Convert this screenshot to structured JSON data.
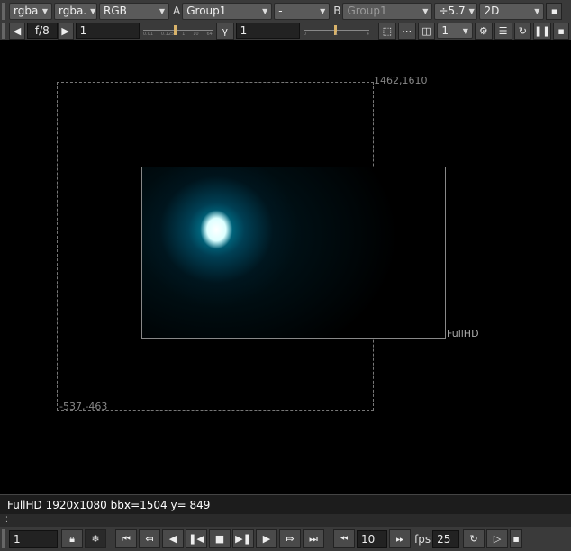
{
  "toolbar1": {
    "channels": "rgba",
    "alpha_channel": "rgba.",
    "colorspace": "RGB",
    "a_label": "A",
    "a_input": "Group1",
    "operation": "-",
    "b_label": "B",
    "b_input": "Group1",
    "gain": "÷5.7",
    "view_mode": "2D"
  },
  "toolbar2": {
    "fstop": "f/8",
    "gain_value": "1",
    "gain_ticks": [
      "0.01",
      "0.125",
      "1",
      "10",
      "64"
    ],
    "gamma_label": "γ",
    "gamma_value": "1",
    "gamma_ticks": [
      "0",
      "1",
      "4"
    ],
    "proxy_value": "1"
  },
  "viewer": {
    "bbox_top_right": "1462,1610",
    "bbox_bottom_left": "-537,-463",
    "format_label": "FullHD"
  },
  "status": {
    "format_info": "FullHD 1920x1080 bb:",
    "cursor": "x=1504 y= 849"
  },
  "playback": {
    "frame": "1",
    "increment": "10",
    "fps_label": "fps",
    "fps_value": "25"
  }
}
